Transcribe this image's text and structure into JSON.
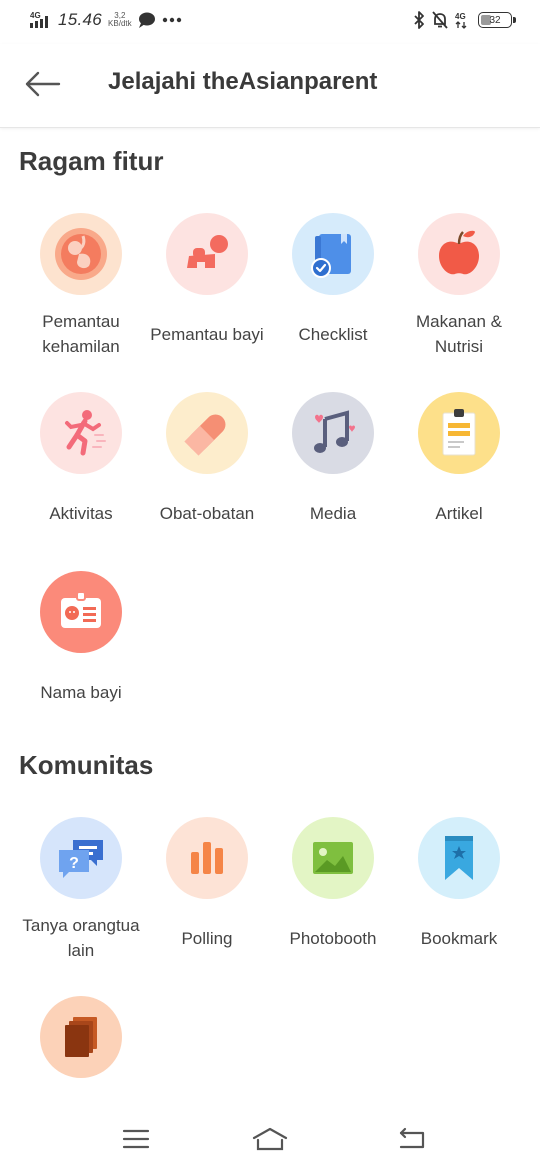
{
  "status_bar": {
    "network": "4G",
    "time": "15.46",
    "speed_value": "3,2",
    "speed_unit": "KB/dtk",
    "network_right": "4G",
    "battery": "32"
  },
  "header": {
    "title": "Jelajahi theAsianparent"
  },
  "sections": {
    "features": {
      "title": "Ragam fitur",
      "items": [
        {
          "label": "Pemantau kehamilan",
          "icon": "pregnancy-icon",
          "bg": "#fde3cf"
        },
        {
          "label": "Pemantau bayi",
          "icon": "baby-crawl-icon",
          "bg": "#fde3e1"
        },
        {
          "label": "Checklist",
          "icon": "checklist-icon",
          "bg": "#d6ebfb"
        },
        {
          "label": "Makanan & Nutrisi",
          "icon": "apple-icon",
          "bg": "#fde3e1"
        },
        {
          "label": "Aktivitas",
          "icon": "running-icon",
          "bg": "#fde3e1"
        },
        {
          "label": "Obat-obatan",
          "icon": "pill-icon",
          "bg": "#fdedcc"
        },
        {
          "label": "Media",
          "icon": "music-note-icon",
          "bg": "#d9dbe4"
        },
        {
          "label": "Artikel",
          "icon": "article-icon",
          "bg": "#fde08a"
        },
        {
          "label": "Nama bayi",
          "icon": "baby-name-card-icon",
          "bg": "#fb8a7a"
        }
      ]
    },
    "community": {
      "title": "Komunitas",
      "items": [
        {
          "label": "Tanya orangtua lain",
          "icon": "chat-question-icon",
          "bg": "#d6e5fb"
        },
        {
          "label": "Polling",
          "icon": "bar-chart-icon",
          "bg": "#fde3d6"
        },
        {
          "label": "Photobooth",
          "icon": "photo-icon",
          "bg": "#e3f5c5"
        },
        {
          "label": "Bookmark",
          "icon": "bookmark-icon",
          "bg": "#d4effb"
        },
        {
          "label": "",
          "icon": "documents-icon",
          "bg": "#fcd2b8"
        }
      ]
    }
  },
  "nav": {
    "items": [
      "menu-icon",
      "home-icon",
      "back-nav-icon"
    ]
  }
}
